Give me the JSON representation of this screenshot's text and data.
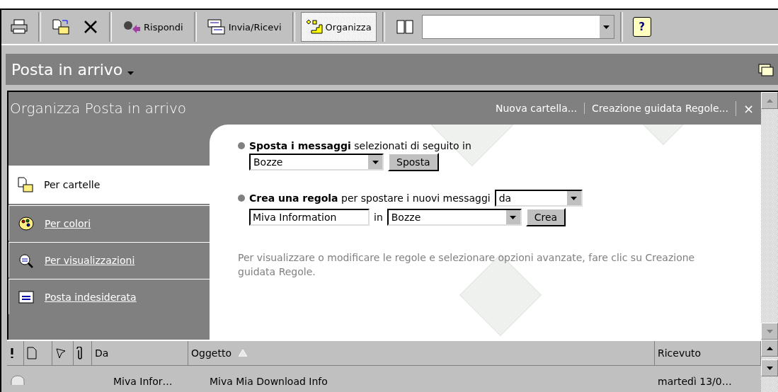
{
  "toolbar": {
    "buttons": [
      {
        "kind": "icon"
      },
      {
        "kind": "sep"
      },
      {
        "kind": "icon"
      },
      {
        "kind": "icon"
      },
      {
        "kind": "sep"
      },
      {
        "kind": "text",
        "label": "Rispondi",
        "selected": false
      },
      {
        "kind": "sep"
      },
      {
        "kind": "text",
        "label": "Invia/Ricevi",
        "selected": false
      },
      {
        "kind": "sep"
      },
      {
        "kind": "text",
        "label": "Organizza",
        "selected": true
      },
      {
        "kind": "sep"
      },
      {
        "kind": "icon"
      },
      {
        "kind": "combo"
      },
      {
        "kind": "sep"
      },
      {
        "kind": "help",
        "label": "?"
      }
    ]
  },
  "folder_bar": {
    "title": "Posta in arrivo"
  },
  "organizer": {
    "title": "Organizza Posta in arrivo",
    "links": [
      "Nuova cartella...",
      "Creazione guidata Regole..."
    ],
    "close": "×",
    "tabs": [
      {
        "label": "Per cartelle",
        "selected": true
      },
      {
        "label": "Per colori",
        "selected": false
      },
      {
        "label": "Per visualizzazioni",
        "selected": false
      },
      {
        "label": "Posta indesiderata",
        "selected": false
      }
    ],
    "move_section": {
      "heading": "**Sposta i messaggi** selezionati di seguito in",
      "folder": "Bozze",
      "button": "Sposta"
    },
    "rule_section": {
      "heading": "**Crea una regola** per spostare i nuovi messaggi",
      "condition": "da",
      "value": "Miva Information",
      "in_label": "in",
      "folder": "Bozze",
      "button": "Crea"
    },
    "note": "Per visualizzare o modificare le regole e selezionare opzioni avanzate, fare clic su Creazione guidata Regole."
  },
  "table": {
    "columns": [
      {
        "kind": "icon"
      },
      {
        "kind": "icon"
      },
      {
        "kind": "icon"
      },
      {
        "kind": "icon"
      },
      {
        "kind": "text",
        "label": "Da"
      },
      {
        "kind": "text",
        "label": "Oggetto",
        "sorted": true
      },
      {
        "kind": "text",
        "label": "Ricevuto"
      }
    ],
    "rows": [
      {
        "from": "Miva Infor…",
        "subject": "Miva Mia Download Info",
        "received": "martedì 13/0…"
      }
    ]
  }
}
